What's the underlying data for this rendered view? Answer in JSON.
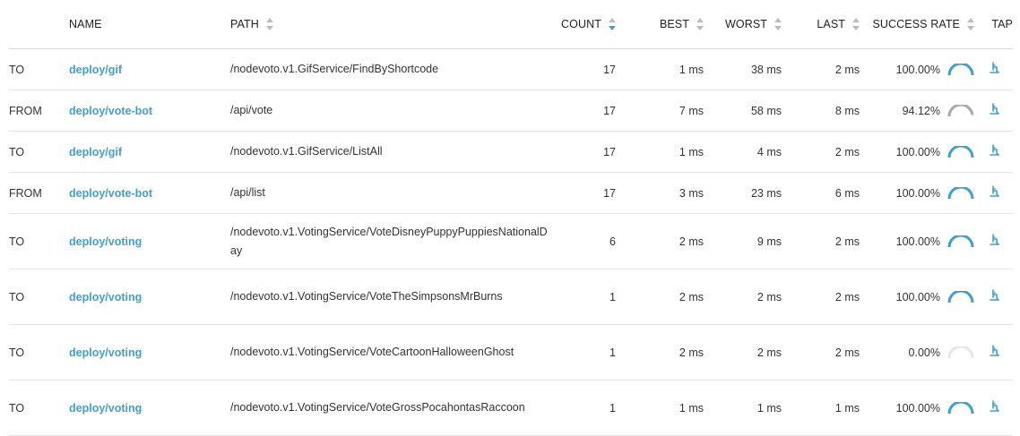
{
  "columns": {
    "direction": "",
    "name": "NAME",
    "path": "PATH",
    "count": "COUNT",
    "best": "BEST",
    "worst": "WORST",
    "last": "LAST",
    "success_rate": "SUCCESS RATE",
    "tap": "TAP"
  },
  "colors": {
    "accent": "#3ea1c9",
    "gauge_warn": "#a8a8a8",
    "gauge_empty": "#e6e6e6"
  },
  "rows": [
    {
      "direction": "TO",
      "name": "deploy/gif",
      "path": "/nodevoto.v1.GifService/FindByShortcode",
      "count": "17",
      "best": "1 ms",
      "worst": "38 ms",
      "last": "2 ms",
      "success": "100.00%",
      "rate": 1.0
    },
    {
      "direction": "FROM",
      "name": "deploy/vote-bot",
      "path": "/api/vote",
      "count": "17",
      "best": "7 ms",
      "worst": "58 ms",
      "last": "8 ms",
      "success": "94.12%",
      "rate": 0.9412
    },
    {
      "direction": "TO",
      "name": "deploy/gif",
      "path": "/nodevoto.v1.GifService/ListAll",
      "count": "17",
      "best": "1 ms",
      "worst": "4 ms",
      "last": "2 ms",
      "success": "100.00%",
      "rate": 1.0
    },
    {
      "direction": "FROM",
      "name": "deploy/vote-bot",
      "path": "/api/list",
      "count": "17",
      "best": "3 ms",
      "worst": "23 ms",
      "last": "6 ms",
      "success": "100.00%",
      "rate": 1.0
    },
    {
      "direction": "TO",
      "name": "deploy/voting",
      "path": "/nodevoto.v1.VotingService/VoteDisneyPuppyPuppiesNationalDay",
      "count": "6",
      "best": "2 ms",
      "worst": "9 ms",
      "last": "2 ms",
      "success": "100.00%",
      "rate": 1.0
    },
    {
      "direction": "TO",
      "name": "deploy/voting",
      "path": "/nodevoto.v1.VotingService/VoteTheSimpsonsMrBurns",
      "count": "1",
      "best": "2 ms",
      "worst": "2 ms",
      "last": "2 ms",
      "success": "100.00%",
      "rate": 1.0
    },
    {
      "direction": "TO",
      "name": "deploy/voting",
      "path": "/nodevoto.v1.VotingService/VoteCartoonHalloweenGhost",
      "count": "1",
      "best": "2 ms",
      "worst": "2 ms",
      "last": "2 ms",
      "success": "0.00%",
      "rate": 0.0
    },
    {
      "direction": "TO",
      "name": "deploy/voting",
      "path": "/nodevoto.v1.VotingService/VoteGrossPocahontasRaccoon",
      "count": "1",
      "best": "1 ms",
      "worst": "1 ms",
      "last": "1 ms",
      "success": "100.00%",
      "rate": 1.0
    }
  ]
}
